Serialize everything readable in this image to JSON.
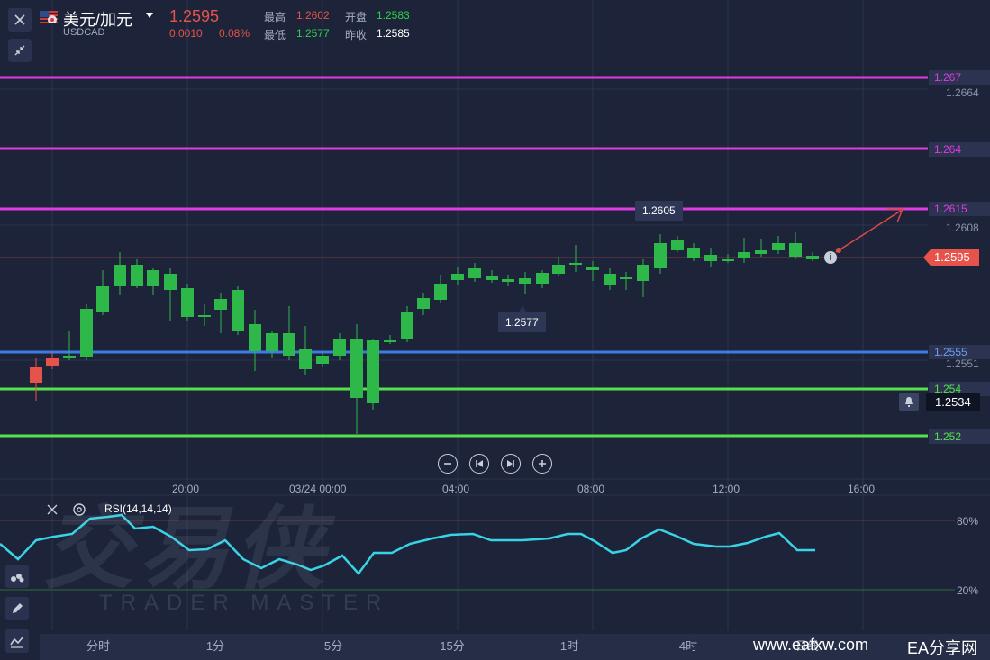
{
  "header": {
    "symbol_name": "美元/加元",
    "symbol_code": "USDCAD",
    "price": "1.2595",
    "change": "0.0010",
    "change_pct": "0.08%",
    "high_label": "最高",
    "high": "1.2602",
    "low_label": "最低",
    "low": "1.2577",
    "open_label": "开盘",
    "open": "1.2583",
    "prev_close_label": "昨收",
    "prev_close": "1.2585"
  },
  "levels": [
    {
      "label": "1.267",
      "color": "#e13ce0"
    },
    {
      "label": "1.264",
      "color": "#e13ce0"
    },
    {
      "label": "1.2615",
      "color": "#e13ce0"
    },
    {
      "label": "1.2555",
      "color": "#3d7be6"
    },
    {
      "label": "1.254",
      "color": "#56e04a"
    },
    {
      "label": "1.252",
      "color": "#56e04a"
    }
  ],
  "y_axis_ticks": [
    "1.2664",
    "1.2608",
    "1.2551"
  ],
  "current_price_tag": "1.2595",
  "alert_price": "1.2534",
  "markers": {
    "high": "1.2605",
    "low": "1.2577"
  },
  "time_axis": [
    "20:00",
    "03/24 00:00",
    "04:00",
    "08:00",
    "12:00",
    "16:00"
  ],
  "rsi": {
    "label": "RSI(14,14,14)",
    "overbought": "80%",
    "oversold": "20%"
  },
  "watermark": {
    "brand": "交易侠",
    "sub": "TRADER MASTER"
  },
  "timeframes": [
    "分时",
    "1分",
    "5分",
    "15分",
    "1时",
    "4时",
    "日线"
  ],
  "footer_site": "www.eafxw.com",
  "footer_brand": "EA分享网",
  "colors": {
    "up": "#e5534b",
    "down": "#2fb84a",
    "rsi_line": "#38d4e6"
  }
}
